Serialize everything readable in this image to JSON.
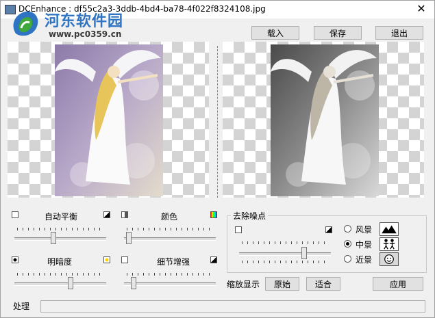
{
  "window": {
    "title": "DCEnhance : df55c2a3-3ddb-4bd4-ba78-4f022f8324108.jpg",
    "close_glyph": "✕"
  },
  "watermark": {
    "name": "河东软件园",
    "url": "www.pc0359.cn"
  },
  "toolbar": {
    "load_label": "载入",
    "save_label": "保存",
    "exit_label": "退出"
  },
  "sliders": {
    "auto_balance": {
      "label": "自动平衡",
      "level": 0.42
    },
    "color": {
      "label": "颜色",
      "level": 0.02
    },
    "brightness": {
      "label": "明暗度",
      "level": 0.62
    },
    "detail": {
      "label": "细节增强",
      "level": 0.08
    }
  },
  "denoise": {
    "title": "去除噪点",
    "level": 0.72,
    "options": [
      {
        "label": "风景",
        "icon": "mountain-icon",
        "selected": false
      },
      {
        "label": "中景",
        "icon": "people-icon",
        "selected": true
      },
      {
        "label": "近景",
        "icon": "face-icon",
        "selected": false
      }
    ]
  },
  "zoom": {
    "label": "缩放显示",
    "original_label": "原始",
    "fit_label": "适合",
    "apply_label": "应用"
  },
  "status": {
    "label": "处理"
  },
  "colors": {
    "wm_blue": "#2f74c2",
    "wm_green": "#3fa83a",
    "angel_bg": "#9a86b5"
  }
}
